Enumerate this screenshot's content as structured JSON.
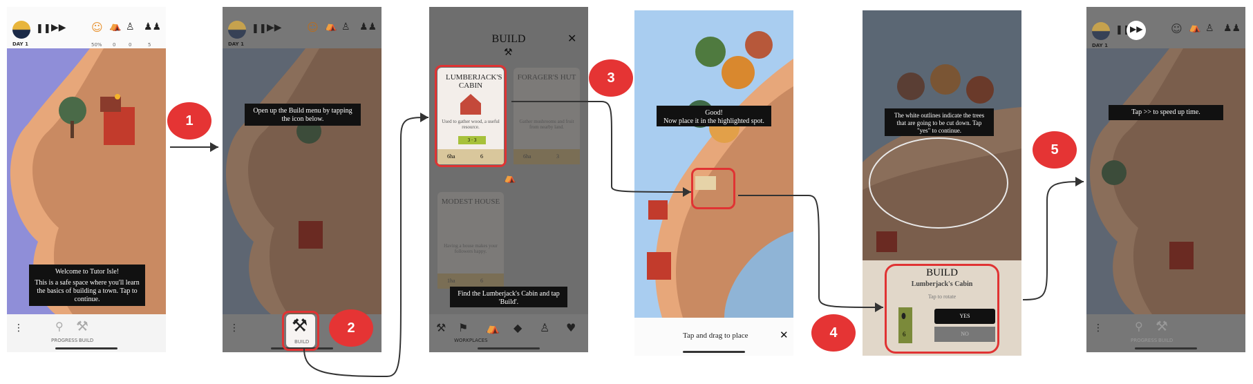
{
  "colors": {
    "accent_red": "#e53434",
    "water": "#8f8ed8",
    "sand": "#e7a77a",
    "grass": "#c98a62",
    "dim": "#6e6e6e"
  },
  "hud": {
    "day": "DAY 1",
    "stats": [
      "50%",
      "0",
      "0",
      "5"
    ]
  },
  "screen1": {
    "tip_line1": "Welcome to Tutor Isle!",
    "tip_line2": "This is a safe space where you'll learn the basics of building a town. Tap to continue.",
    "bottom_labels": [
      "PROGRESS",
      "BUILD"
    ]
  },
  "screen2": {
    "tip": "Open up the Build menu by tapping the icon below.",
    "build_label": "BUILD"
  },
  "screen3": {
    "title": "BUILD",
    "cards": [
      {
        "name": "LUMBERJACK'S CABIN",
        "desc": "Used to gather wood, a useful resource.",
        "cost_a": "3",
        "cost_b": "3",
        "stat_a": "6ha",
        "stat_b": "6"
      },
      {
        "name": "FORAGER'S HUT",
        "desc": "Gather mushrooms and fruit from nearby land.",
        "stat_a": "6ha",
        "stat_b": "3"
      },
      {
        "name": "MODEST HOUSE",
        "desc": "Having a house makes your followers happy.",
        "stat_a": "1ha",
        "stat_b": "6"
      }
    ],
    "tip": "Find the Lumberjack's Cabin and tap 'Build'.",
    "tab_label": "WORKPLACES"
  },
  "screen4": {
    "tip": "Good!\nNow place it in the highlighted spot.",
    "bottom": "Tap and drag to place",
    "close": "✕"
  },
  "screen5": {
    "tip": "The white outlines indicate the trees that are going to be cut down. Tap \"yes\" to continue.",
    "panel_title": "BUILD",
    "panel_sub": "Lumberjack's Cabin",
    "rotate": "Tap to rotate",
    "wood": "6",
    "yes": "YES",
    "no": "NO"
  },
  "screen6": {
    "tip": "Tap >> to speed up time.",
    "bottom_labels": [
      "PROGRESS",
      "BUILD"
    ]
  },
  "steps": [
    "1",
    "2",
    "3",
    "4",
    "5"
  ]
}
